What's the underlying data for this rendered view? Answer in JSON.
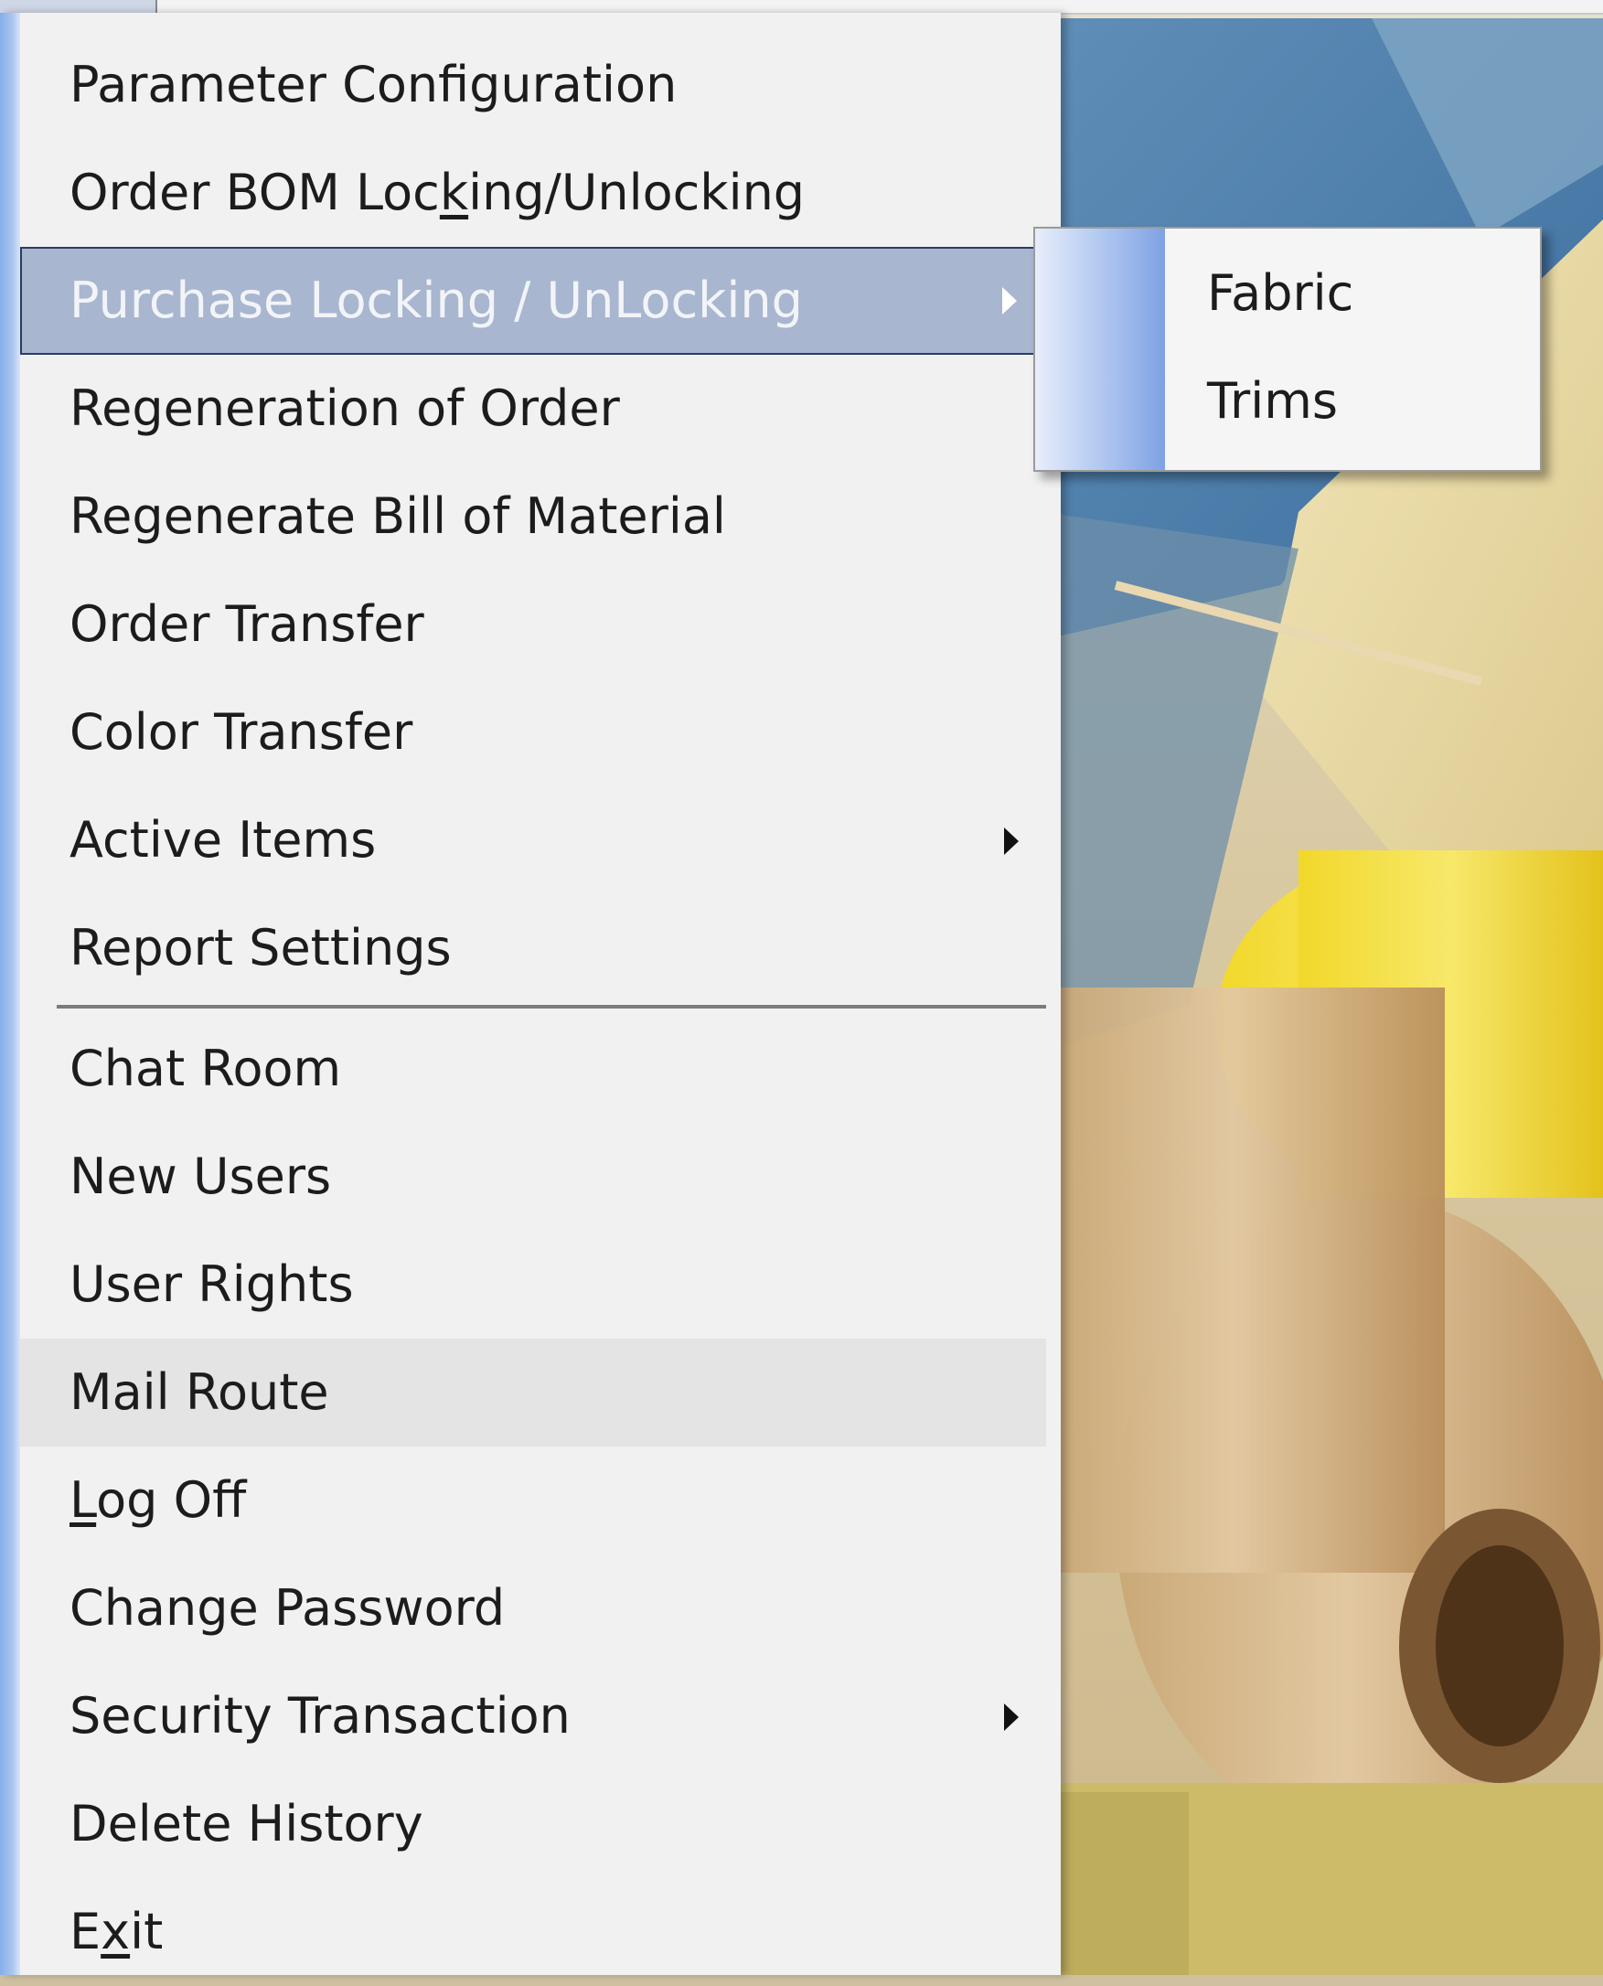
{
  "menu": {
    "items": [
      {
        "label": "Parameter Configuration",
        "submenu": false
      },
      {
        "label": "Order BOM Locking/Unlocking",
        "submenu": false,
        "underline_char": "k"
      },
      {
        "label": "Purchase Locking / UnLocking",
        "submenu": true,
        "state": "selected"
      },
      {
        "label": "Regeneration of Order",
        "submenu": false
      },
      {
        "label": "Regenerate Bill of Material",
        "submenu": false
      },
      {
        "label": "Order Transfer",
        "submenu": false
      },
      {
        "label": "Color Transfer",
        "submenu": false
      },
      {
        "label": "Active Items",
        "submenu": true
      },
      {
        "label": "Report Settings",
        "submenu": false
      },
      {
        "label": "Chat Room",
        "submenu": false
      },
      {
        "label": "New Users",
        "submenu": false
      },
      {
        "label": "User Rights",
        "submenu": false
      },
      {
        "label": "Mail Route",
        "submenu": false,
        "state": "hover"
      },
      {
        "label": "Log Off",
        "submenu": false,
        "underline_char": "L"
      },
      {
        "label": "Change Password",
        "submenu": false
      },
      {
        "label": "Security Transaction",
        "submenu": true
      },
      {
        "label": "Delete History",
        "submenu": false
      },
      {
        "label": "Exit",
        "submenu": false,
        "underline_char": "x"
      }
    ]
  },
  "submenu": {
    "parent": "Purchase Locking / UnLocking",
    "items": [
      {
        "label": "Fabric"
      },
      {
        "label": "Trims"
      }
    ]
  },
  "colors": {
    "menu_background": "#f1f1f1",
    "selected_background": "#a8b6d0",
    "selected_border": "#2b3b63",
    "hover_background": "#e4e4e4",
    "gutter_blue": "#86aee9",
    "text": "#1c1c1c"
  },
  "icons": {
    "submenu_indicator": "chevron-right-icon"
  }
}
